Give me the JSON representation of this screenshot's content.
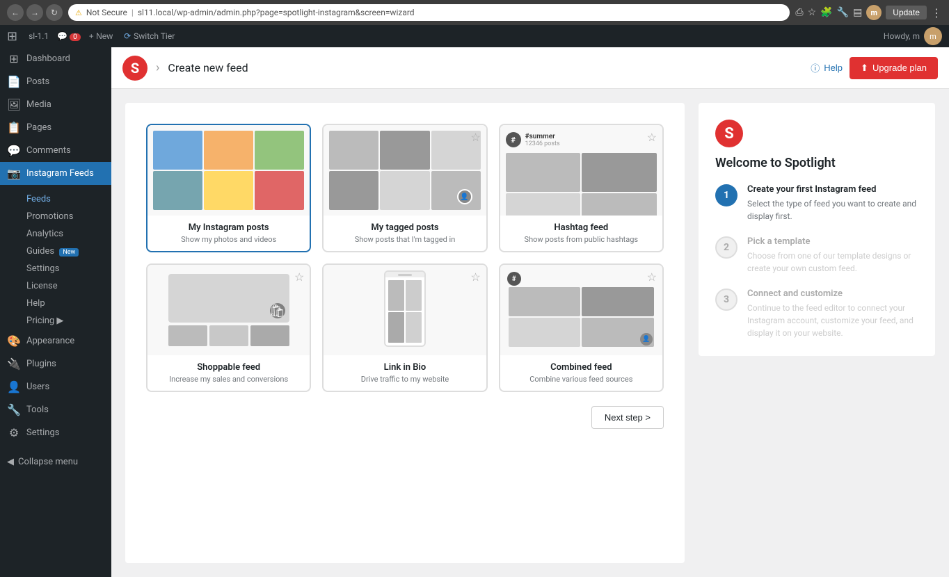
{
  "browser": {
    "back_label": "←",
    "forward_label": "→",
    "refresh_label": "↻",
    "url": "sl11.local/wp-admin/admin.php?page=spotlight-instagram&screen=wizard",
    "not_secure_label": "Not Secure",
    "update_label": "Update"
  },
  "wp_admin_bar": {
    "logo": "W",
    "site_label": "sl-1.1",
    "comments_label": "0",
    "new_label": "+ New",
    "switch_tier_label": "Switch Tier",
    "howdy_label": "Howdy, m",
    "avatar_label": "m"
  },
  "sidebar": {
    "dashboard_label": "Dashboard",
    "posts_label": "Posts",
    "media_label": "Media",
    "pages_label": "Pages",
    "comments_label": "Comments",
    "instagram_feeds_label": "Instagram Feeds",
    "feeds_label": "Feeds",
    "promotions_label": "Promotions",
    "analytics_label": "Analytics",
    "guides_label": "Guides",
    "new_badge_label": "New",
    "settings_label": "Settings",
    "license_label": "License",
    "help_label": "Help",
    "pricing_label": "Pricing ▶",
    "appearance_label": "Appearance",
    "plugins_label": "Plugins",
    "users_label": "Users",
    "tools_label": "Tools",
    "settings2_label": "Settings",
    "collapse_menu_label": "Collapse menu"
  },
  "header": {
    "logo_letter": "S",
    "page_title": "Create new feed",
    "help_label": "Help",
    "upgrade_label": "Upgrade plan",
    "upgrade_icon": "⬆"
  },
  "feed_types": {
    "cards": [
      {
        "id": "my-instagram",
        "title": "My Instagram posts",
        "description": "Show my photos and videos",
        "selected": true
      },
      {
        "id": "my-tagged",
        "title": "My tagged posts",
        "description": "Show posts that I'm tagged in",
        "selected": false
      },
      {
        "id": "hashtag",
        "title": "Hashtag feed",
        "description": "Show posts from public hashtags",
        "selected": false
      },
      {
        "id": "shoppable",
        "title": "Shoppable feed",
        "description": "Increase my sales and conversions",
        "selected": false
      },
      {
        "id": "link-in-bio",
        "title": "Link in Bio",
        "description": "Drive traffic to my website",
        "selected": false
      },
      {
        "id": "combined",
        "title": "Combined feed",
        "description": "Combine various feed sources",
        "selected": false
      }
    ],
    "next_label": "Next step >"
  },
  "right_panel": {
    "logo_letter": "S",
    "welcome_title": "Welcome to Spotlight",
    "steps": [
      {
        "number": "1",
        "title": "Create your first Instagram feed",
        "description": "Select the type of feed you want to create and display first.",
        "active": true
      },
      {
        "number": "2",
        "title": "Pick a template",
        "description": "Choose from one of our template designs or create your own custom feed.",
        "active": false
      },
      {
        "number": "3",
        "title": "Connect and customize",
        "description": "Continue to the feed editor to connect your Instagram account, customize your feed, and display it on your website.",
        "active": false
      }
    ]
  }
}
